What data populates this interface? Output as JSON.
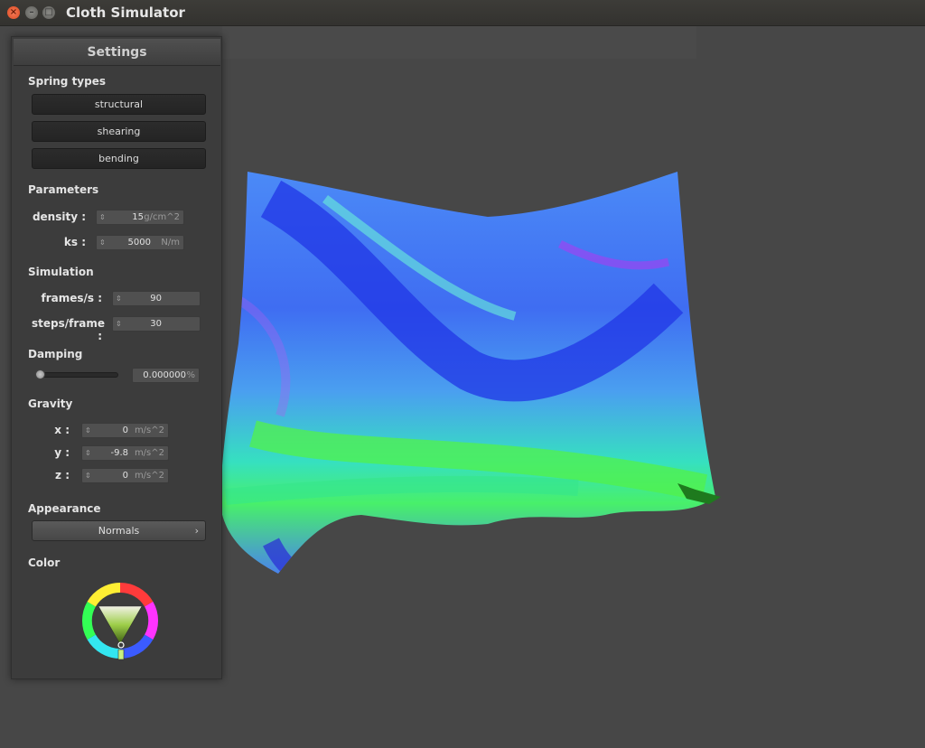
{
  "window": {
    "title": "Cloth Simulator"
  },
  "panel": {
    "title": "Settings",
    "spring_types": {
      "heading": "Spring types",
      "buttons": [
        "structural",
        "shearing",
        "bending"
      ]
    },
    "parameters": {
      "heading": "Parameters",
      "density": {
        "label": "density :",
        "value": "15",
        "unit": "g/cm^2"
      },
      "ks": {
        "label": "ks :",
        "value": "5000",
        "unit": "N/m"
      }
    },
    "simulation": {
      "heading": "Simulation",
      "fps": {
        "label": "frames/s :",
        "value": "90"
      },
      "steps": {
        "label": "steps/frame :",
        "value": "30"
      }
    },
    "damping": {
      "heading": "Damping",
      "value": "0.000000",
      "unit": "%",
      "level": 0
    },
    "gravity": {
      "heading": "Gravity",
      "x": {
        "label": "x :",
        "value": "0",
        "unit": "m/s^2"
      },
      "y": {
        "label": "y :",
        "value": "-9.8",
        "unit": "m/s^2"
      },
      "z": {
        "label": "z :",
        "value": "0",
        "unit": "m/s^2"
      }
    },
    "appearance": {
      "heading": "Appearance",
      "selected": "Normals"
    },
    "color": {
      "heading": "Color",
      "selected_hex": "#9ccd47"
    }
  },
  "icons": {
    "close": "close-icon",
    "minimize": "minimize-icon",
    "maximize": "maximize-icon",
    "dropdown": "chevron-right-icon",
    "spinner": "spinner-arrows-icon"
  }
}
